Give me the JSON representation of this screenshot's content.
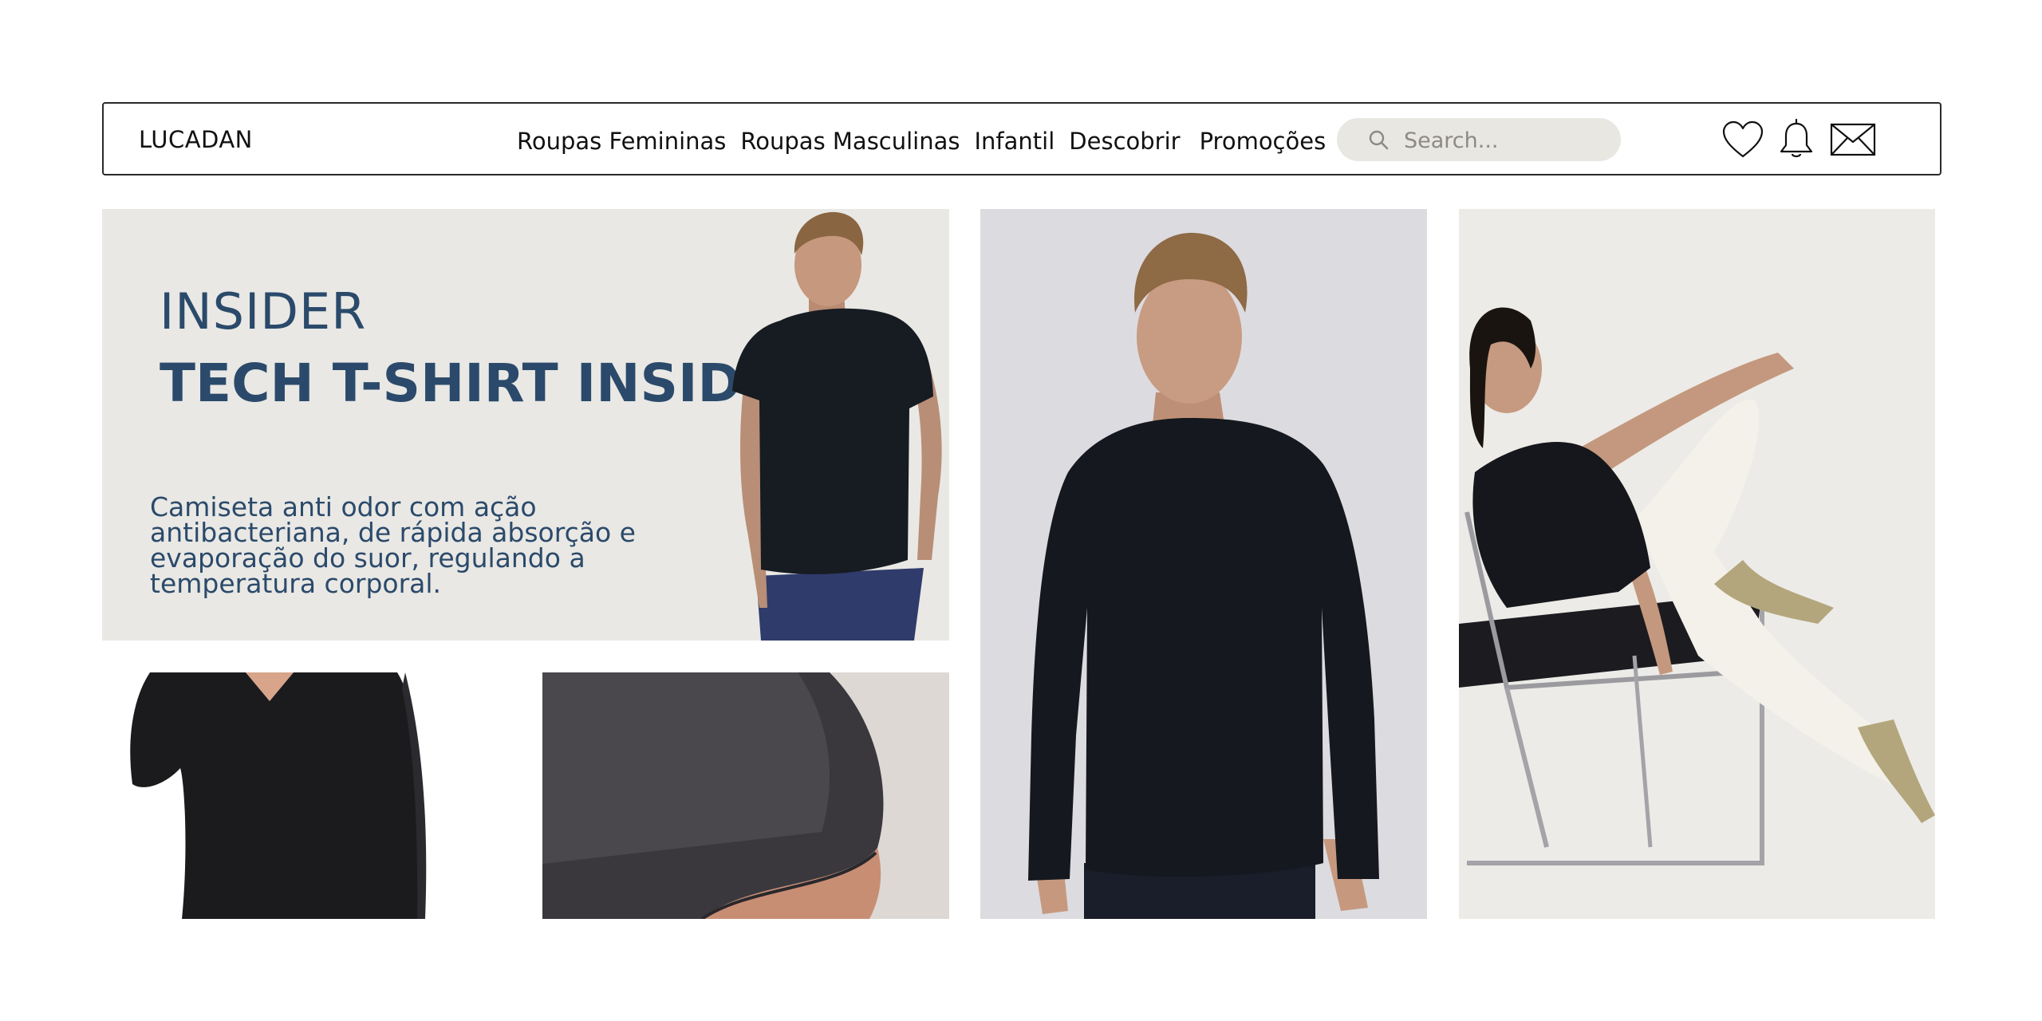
{
  "nav": {
    "logo": "LUCADAN",
    "menu": [
      "Roupas Femininas",
      "Roupas Masculinas",
      "Infantil",
      "Descobrir",
      "Promoções"
    ],
    "search_placeholder": "Search...",
    "icons": [
      "search-icon",
      "heart-icon",
      "bell-icon",
      "mail-icon"
    ]
  },
  "hero": {
    "kicker": "INSIDER",
    "title": "TECH T-SHIRT INSIDER",
    "description": "Camiseta anti odor com ação antibacteriana, de rápida absorção e evaporação do suor, regulando a temperatura corporal."
  },
  "colors": {
    "brand_text": "#2b4a6b",
    "hero_background": "#e9e8e4",
    "search_background": "#e9e7e2"
  }
}
